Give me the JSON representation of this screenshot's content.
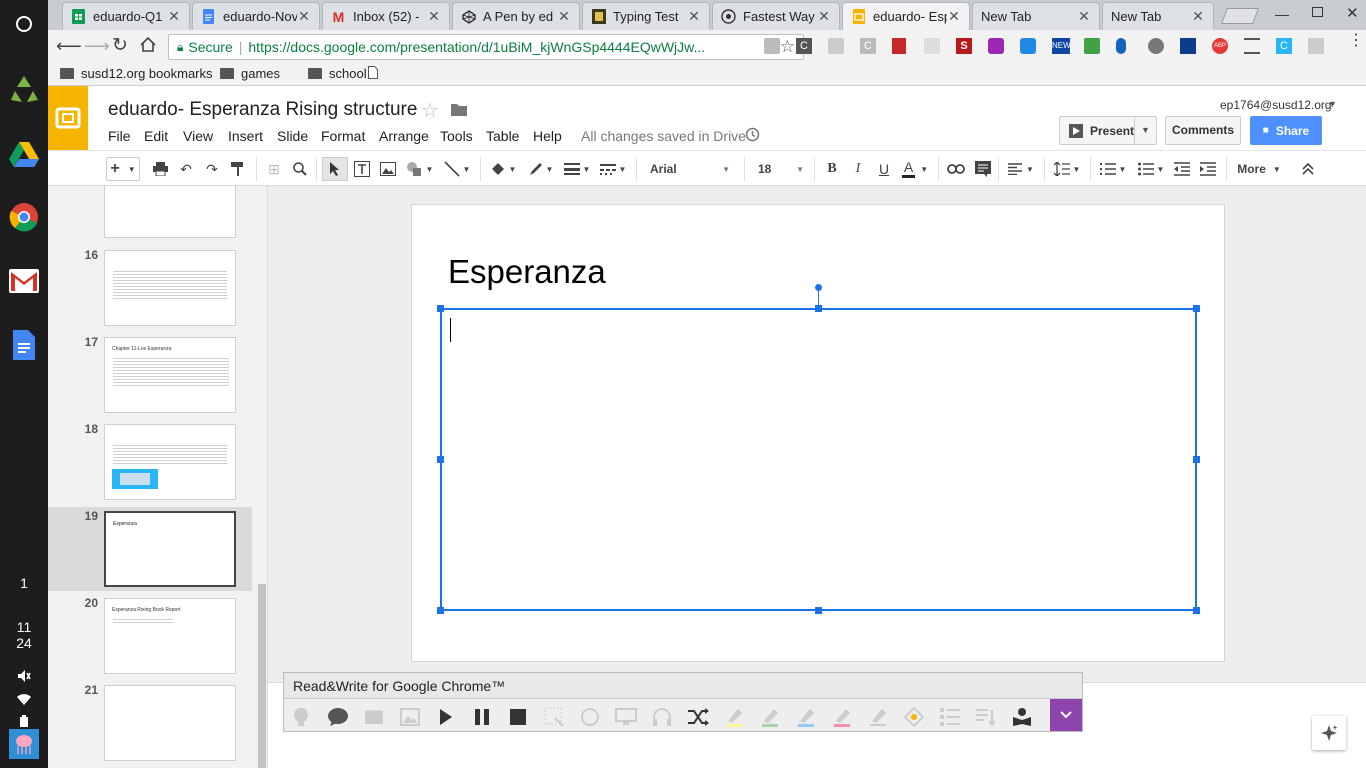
{
  "shelf": {
    "time_hour": "11",
    "time_min": "24",
    "page_num": "1"
  },
  "tabs": [
    {
      "title": "eduardo-Q1",
      "icon": "sheets-icon",
      "color": "#0f9d58"
    },
    {
      "title": "eduardo-Nov",
      "icon": "docs-icon",
      "color": "#4285f4"
    },
    {
      "title": "Inbox (52) -",
      "icon": "gmail-icon",
      "color": "#d93025"
    },
    {
      "title": "A Pen by ed",
      "icon": "codepen-icon",
      "color": "#222222"
    },
    {
      "title": "Typing Test",
      "icon": "typing-icon",
      "color": "#6b5a2a"
    },
    {
      "title": "Fastest Way",
      "icon": "web-icon",
      "color": "#444444"
    },
    {
      "title": "eduardo- Esp",
      "icon": "slides-icon",
      "color": "#f4b400"
    },
    {
      "title": "New Tab",
      "icon": "",
      "color": ""
    },
    {
      "title": "New Tab",
      "icon": "",
      "color": ""
    }
  ],
  "omnibox": {
    "secure": "Secure",
    "url": "https://docs.google.com/presentation/d/1uBiM_kjWnGSp4444EQwWjJw..."
  },
  "bookmarks": [
    {
      "label": "susd12.org bookmarks"
    },
    {
      "label": "games"
    },
    {
      "label": "school"
    }
  ],
  "doc": {
    "title": "eduardo- Esperanza Rising structure",
    "account": "ep1764@susd12.org",
    "save_status": "All changes saved in Drive",
    "present": "Present",
    "comments": "Comments",
    "share": "Share"
  },
  "menus": [
    "File",
    "Edit",
    "View",
    "Insert",
    "Slide",
    "Format",
    "Arrange",
    "Tools",
    "Table",
    "Help"
  ],
  "format": {
    "font": "Arial",
    "size": "18",
    "more": "More"
  },
  "slides": [
    {
      "num": "16",
      "title": ""
    },
    {
      "num": "17",
      "title": "Chapter 11-Los Esperanza"
    },
    {
      "num": "18",
      "title": ""
    },
    {
      "num": "19",
      "title": "Esperanza"
    },
    {
      "num": "20",
      "title": "Esperanza Rising Book Report"
    },
    {
      "num": "21",
      "title": ""
    }
  ],
  "current_slide": {
    "title": "Esperanza"
  },
  "readwrite": {
    "title": "Read&Write for Google Chrome™"
  },
  "colors": {
    "accent": "#4285f4",
    "selection": "#1a73e8",
    "slides_yellow": "#f4b400",
    "rw_purple": "#8e44ad"
  }
}
